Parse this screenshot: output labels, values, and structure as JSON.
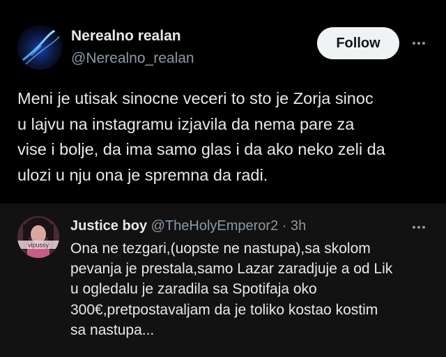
{
  "main_tweet": {
    "display_name": "Nerealno realan",
    "handle": "@Nerealno_realan",
    "follow_label": "Follow",
    "more_icon": "more-horizontal-icon",
    "text": "Meni je utisak sinocne veceri to sto je Zorja sinoc\nu lajvu na instagramu izjavila da nema pare za\nvise i bolje, da ima samo glas i da ako neko zeli da\nulozi u nju ona je spremna da radi."
  },
  "reply": {
    "display_name": "Justice boy",
    "handle": "@TheHolyEmperor2",
    "separator": "·",
    "time": "3h",
    "avatar_overlay_text": "vipussy",
    "more_icon": "more-horizontal-icon",
    "text": "Ona ne tezgari,(uopste ne nastupa),sa skolom\npevanja je prestala,samo Lazar zaradjuje a od Lik\nu ogledalu je zaradila sa Spotifaja oko\n300€,pretpostavaljam da je toliko kostao kostim\nsa nastupa..."
  },
  "colors": {
    "background": "#000000",
    "reply_background": "#121212",
    "primary_text": "#e7e9ea",
    "secondary_text": "#8b98a5",
    "follow_button_bg": "#eff3f4",
    "follow_button_text": "#0f1419"
  }
}
